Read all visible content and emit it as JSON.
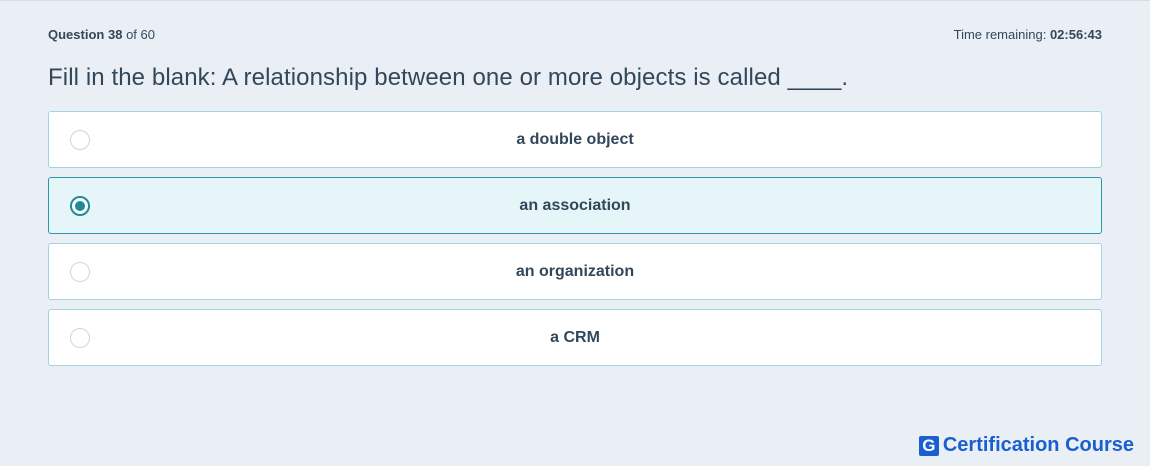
{
  "header": {
    "question_label": "Question",
    "question_number": "38",
    "of_text": "of 60",
    "time_label": "Time remaining:",
    "time_value": "02:56:43"
  },
  "question": {
    "text": "Fill in the blank: A relationship between one or more objects is called ____."
  },
  "options": [
    {
      "label": "a double object",
      "selected": false
    },
    {
      "label": "an association",
      "selected": true
    },
    {
      "label": "an organization",
      "selected": false
    },
    {
      "label": "a CRM",
      "selected": false
    }
  ],
  "brand": {
    "logo_letter": "G",
    "name": "Certification Course",
    "color": "#1a5fcf"
  },
  "colors": {
    "accent": "#1f8a99",
    "selected_bg": "#e5f5f8",
    "page_bg": "#eaeff6"
  }
}
